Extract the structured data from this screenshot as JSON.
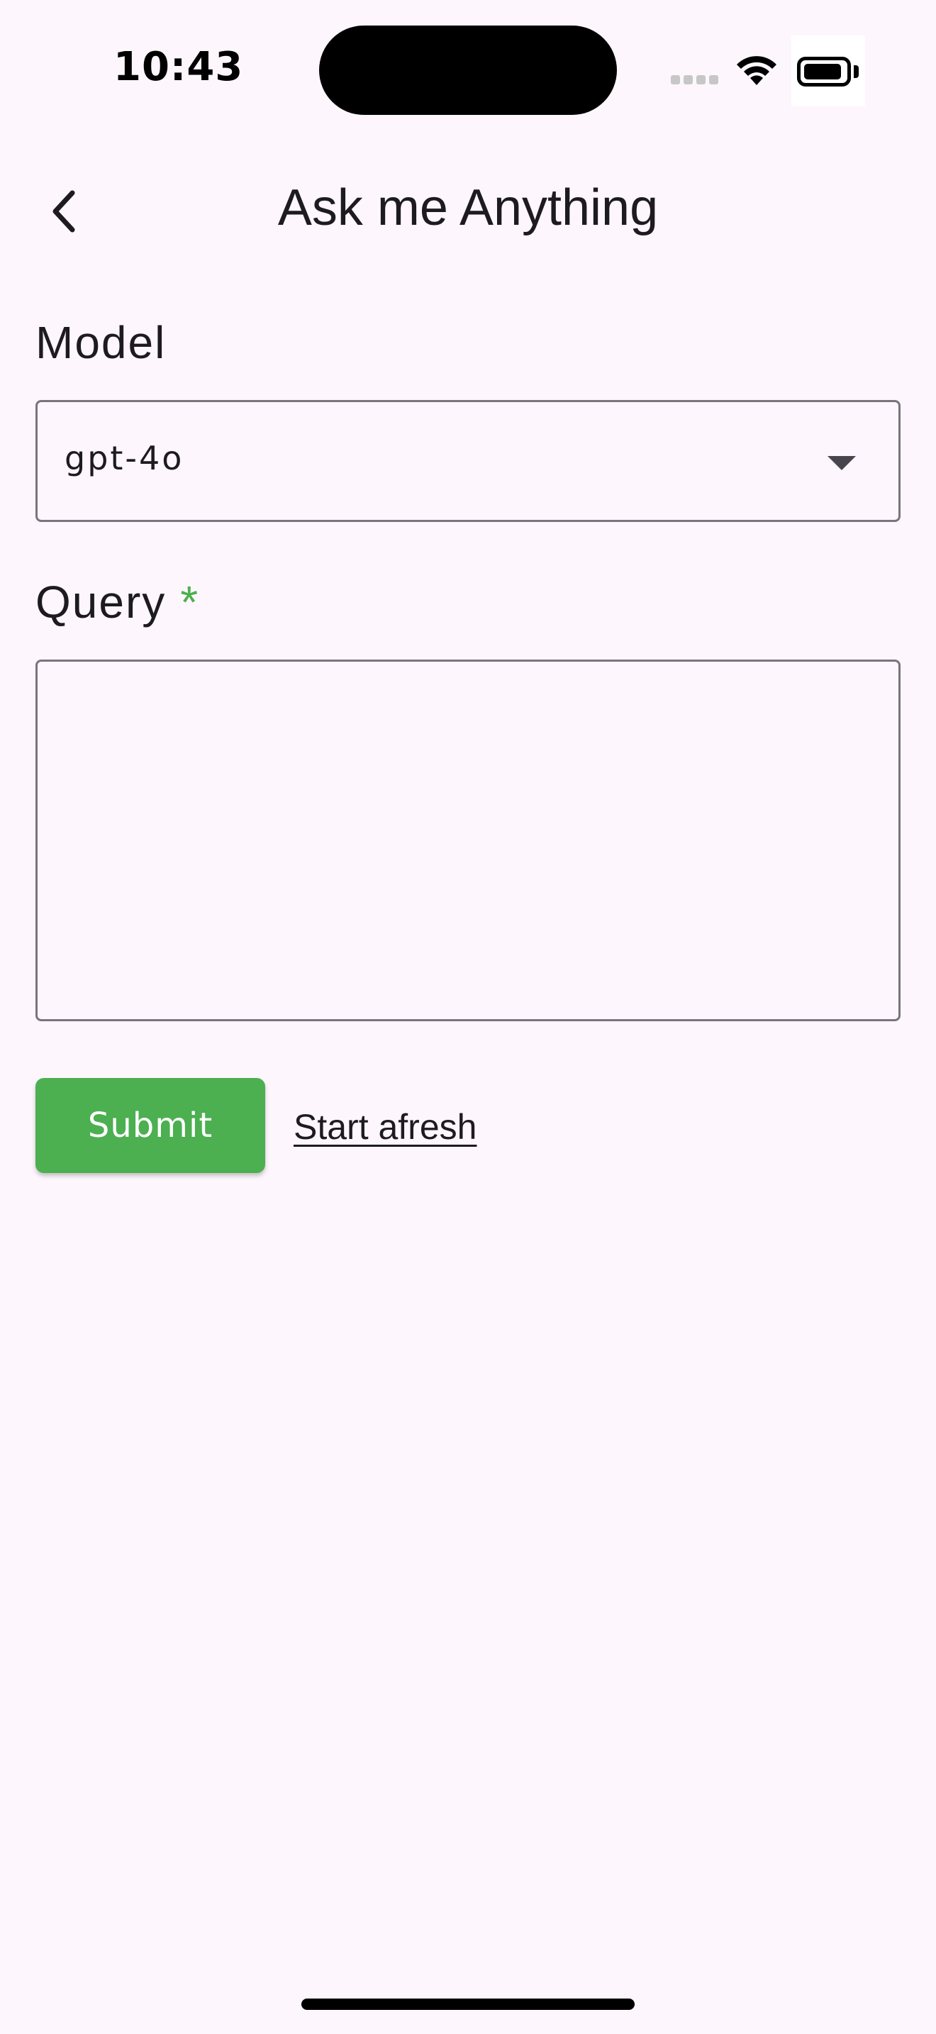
{
  "status_bar": {
    "time": "10:43"
  },
  "app_bar": {
    "title": "Ask me Anything",
    "back_icon": "chevron-left-icon"
  },
  "form": {
    "model": {
      "label": "Model",
      "selected": "gpt-4o",
      "icon": "dropdown-arrow-icon"
    },
    "query": {
      "label": "Query",
      "required_mark": "*",
      "value": ""
    },
    "submit_label": "Submit",
    "reset_label": "Start afresh"
  },
  "colors": {
    "background": "#fdf6fc",
    "accent": "#4caf50",
    "border": "#79747e",
    "text": "#1d1b20"
  }
}
